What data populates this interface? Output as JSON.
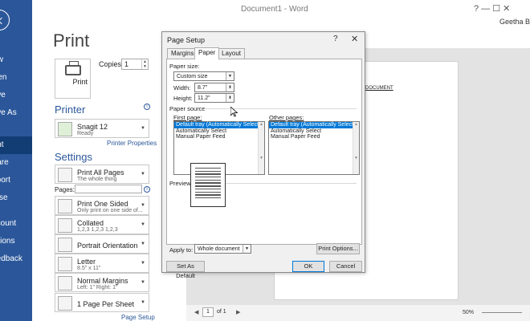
{
  "window": {
    "title": "Document1 - Word",
    "user": "Geetha Bhim",
    "controls": "?    —    ☐    ✕"
  },
  "rail": [
    {
      "label": "New",
      "selected": false
    },
    {
      "label": "Open",
      "selected": false
    },
    {
      "label": "Save",
      "selected": false
    },
    {
      "label": "Save As",
      "selected": false
    },
    {
      "label": "Print",
      "selected": true
    },
    {
      "label": "Share",
      "selected": false
    },
    {
      "label": "Export",
      "selected": false
    },
    {
      "label": "Close",
      "selected": false
    },
    {
      "label": "Account",
      "selected": false
    },
    {
      "label": "Options",
      "selected": false
    },
    {
      "label": "Feedback",
      "selected": false
    }
  ],
  "print": {
    "heading": "Print",
    "button_label": "Print",
    "copies_label": "Copies:",
    "copies_value": "1",
    "printer_heading": "Printer",
    "printer_name": "Snagit 12",
    "printer_status": "Ready",
    "printer_properties": "Printer Properties",
    "settings_heading": "Settings",
    "pages_label": "Pages:",
    "page_setup": "Page Setup",
    "settings": [
      {
        "line1": "Print All Pages",
        "line2": "The whole thing"
      },
      {
        "line1": "Print One Sided",
        "line2": "Only print on one side of..."
      },
      {
        "line1": "Collated",
        "line2": "1,2,3    1,2,3    1,2,3"
      },
      {
        "line1": "Portrait Orientation",
        "line2": ""
      },
      {
        "line1": "Letter",
        "line2": "8.5\" x 11\""
      },
      {
        "line1": "Normal Margins",
        "line2": "Left: 1\"    Right: 1\""
      },
      {
        "line1": "1 Page Per Sheet",
        "line2": ""
      }
    ]
  },
  "preview": {
    "doc_text": "DOCUMENT",
    "page_current": "1",
    "page_of": "of 1",
    "zoom": "50%"
  },
  "dialog": {
    "title": "Page Setup",
    "help": "?",
    "close": "✕",
    "tabs": [
      {
        "label": "Margins",
        "active": false
      },
      {
        "label": "Paper",
        "active": true
      },
      {
        "label": "Layout",
        "active": false
      }
    ],
    "paper_size_label": "Paper size:",
    "paper_size_value": "Custom size",
    "width_label": "Width:",
    "width_value": "8.7\"",
    "height_label": "Height:",
    "height_value": "11.2\"",
    "paper_source_label": "Paper source",
    "first_page_label": "First page:",
    "other_pages_label": "Other pages:",
    "first_page_items": [
      {
        "text": "Default tray (Automatically Select)",
        "selected": true
      },
      {
        "text": "Automatically Select",
        "selected": false
      },
      {
        "text": "Manual Paper Feed",
        "selected": false
      }
    ],
    "other_pages_items": [
      {
        "text": "Default tray (Automatically Select)",
        "selected": true
      },
      {
        "text": "Automatically Select",
        "selected": false
      },
      {
        "text": "Manual Paper Feed",
        "selected": false
      }
    ],
    "preview_label": "Preview",
    "apply_to_label": "Apply to:",
    "apply_to_value": "Whole document",
    "print_options": "Print Options...",
    "set_default": "Set As Default",
    "ok": "OK",
    "cancel": "Cancel"
  }
}
